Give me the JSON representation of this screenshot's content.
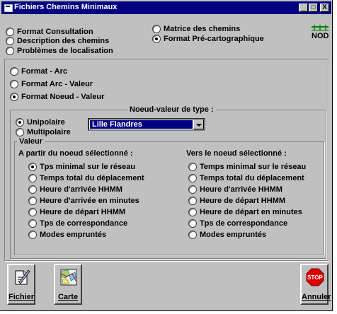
{
  "window": {
    "title": "Fichiers Chemins Minimaux",
    "controls": {
      "minimize": "_",
      "maximize": "□",
      "close": "X"
    }
  },
  "top_options": {
    "format_consultation": "Format Consultation",
    "description_chemins": "Description des chemins",
    "problemes_localisation": "Problèmes de localisation",
    "matrice_chemins": "Matrice des chemins",
    "format_precarto": "Format Pré-cartographique"
  },
  "logo": {
    "text": "NOD",
    "icon": "nod-network-icon"
  },
  "format_options": {
    "arc": "Format - Arc",
    "arc_valeur": "Format Arc - Valeur",
    "noeud_valeur": "Format Noeud - Valeur"
  },
  "noeud_valeur": {
    "legend": "Noeud-valeur de type :",
    "unipolaire": "Unipolaire",
    "multipolaire": "Multipolaire",
    "selected_node": "Lille Flandres"
  },
  "valeur": {
    "legend": "Valeur",
    "from_header": "A partir du noeud sélectionné :",
    "to_header": "Vers le noeud sélectionné :",
    "from_options": [
      "Tps minimal sur le réseau",
      "Temps total du déplacement",
      "Heure d'arrivée HHMM",
      "Heure d'arrivée en minutes",
      "Heure de départ HHMM",
      "Tps de correspondance",
      "Modes empruntés"
    ],
    "to_options": [
      "Temps minimal sur le réseau",
      "Temps total du déplacement",
      "Heure d'arrivée HHMM",
      "Heure de départ HHMM",
      "Heure de départ en minutes",
      "Tps de correspondance",
      "Modes empruntés"
    ]
  },
  "buttons": {
    "fichier": "Fichier",
    "carte": "Carte",
    "annuler": "Annuler",
    "stop_text": "STOP"
  }
}
